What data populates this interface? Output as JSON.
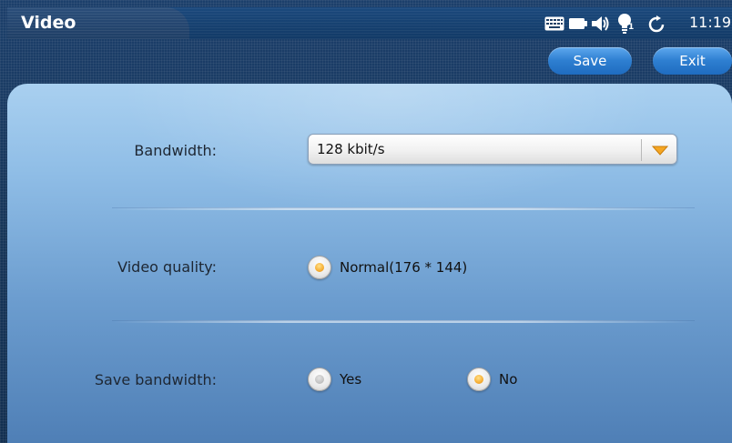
{
  "header": {
    "title": "Video",
    "clock": "11:19",
    "status_icons": [
      "keyboard-icon",
      "battery-icon",
      "speaker-icon",
      "notification-bulb-icon",
      "sync-icon"
    ],
    "notification_count": "1",
    "save_label": "Save",
    "exit_label": "Exit"
  },
  "form": {
    "bandwidth": {
      "label": "Bandwidth:",
      "value": "128 kbit/s"
    },
    "video_quality": {
      "label": "Video quality:",
      "options": [
        {
          "label": "Normal(176 * 144)",
          "selected": true
        }
      ]
    },
    "save_bandwidth": {
      "label": "Save bandwidth:",
      "options": [
        {
          "label": "Yes",
          "selected": false
        },
        {
          "label": "No",
          "selected": true
        }
      ]
    }
  },
  "colors": {
    "accent": "#f5a623",
    "button": "#2e7fd1"
  }
}
